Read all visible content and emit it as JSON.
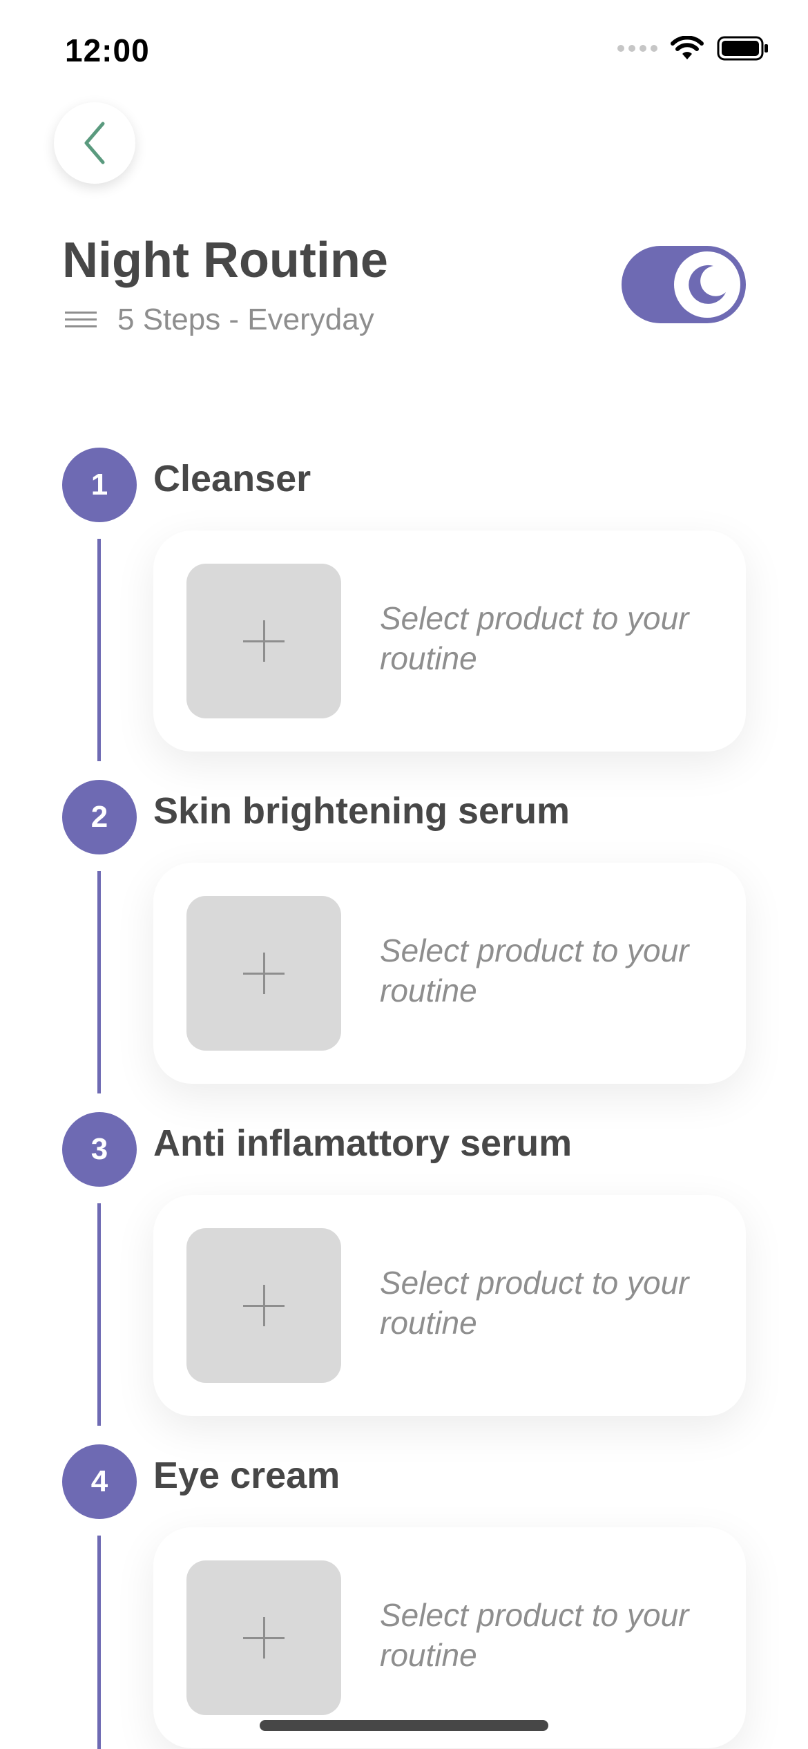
{
  "status_bar": {
    "time": "12:00"
  },
  "header": {
    "title": "Night Routine",
    "subtitle": "5 Steps - Everyday"
  },
  "theme": {
    "accent": "#6e6ab3",
    "title_color": "#474747",
    "muted_text": "#8e8e8e",
    "placeholder_bg": "#d9d9d9"
  },
  "toggle": {
    "state": "on",
    "icon": "moon-icon"
  },
  "steps": [
    {
      "number": "1",
      "title": "Cleanser",
      "placeholder": "Select product to your routine"
    },
    {
      "number": "2",
      "title": "Skin brightening serum",
      "placeholder": "Select product to your routine"
    },
    {
      "number": "3",
      "title": "Anti inflamattory serum",
      "placeholder": "Select product to your routine"
    },
    {
      "number": "4",
      "title": "Eye cream",
      "placeholder": "Select product to your routine"
    }
  ]
}
